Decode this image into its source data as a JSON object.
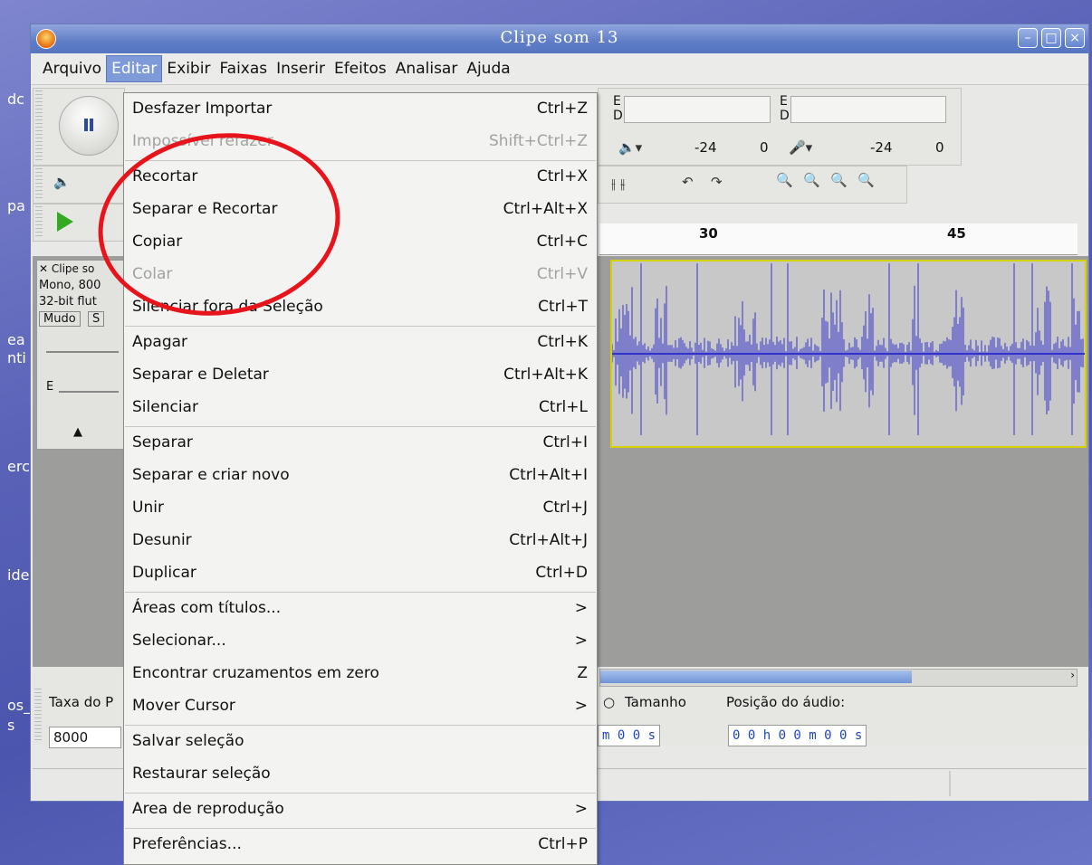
{
  "window": {
    "title": "Clipe som 13"
  },
  "menubar": [
    {
      "label": "Arquivo",
      "active": false
    },
    {
      "label": "Editar",
      "active": true
    },
    {
      "label": "Exibir",
      "active": false
    },
    {
      "label": "Faixas",
      "active": false
    },
    {
      "label": "Inserir",
      "active": false
    },
    {
      "label": "Efeitos",
      "active": false
    },
    {
      "label": "Analisar",
      "active": false
    },
    {
      "label": "Ajuda",
      "active": false
    }
  ],
  "meters": {
    "e": "E",
    "d": "D",
    "db1": "-24",
    "db1b": "0",
    "db2": "-24",
    "db2b": "0"
  },
  "ruler": {
    "t30": "30",
    "t45": "45"
  },
  "track": {
    "name": "Clipe so",
    "info1": "Mono, 800",
    "info2": "32-bit flut",
    "mute": "Mudo",
    "solo": "S",
    "gain_label": "E"
  },
  "selection_bar": {
    "rate_label": "Taxa do P",
    "rate_value": "8000",
    "length_label": "Tamanho",
    "position_label": "Posição do áudio:",
    "time1": "m 0 0 s",
    "time2": "0 0 h 0 0 m 0 0 s"
  },
  "edit_menu": {
    "items": [
      {
        "label": "Desfazer Importar",
        "accel": "Ctrl+Z",
        "disabled": false,
        "sep_after": false
      },
      {
        "label": "Impossível refazer",
        "accel": "Shift+Ctrl+Z",
        "disabled": true,
        "sep_after": true
      },
      {
        "label": "Recortar",
        "accel": "Ctrl+X",
        "disabled": false,
        "sep_after": false
      },
      {
        "label": "Separar e Recortar",
        "accel": "Ctrl+Alt+X",
        "disabled": false,
        "sep_after": false
      },
      {
        "label": "Copiar",
        "accel": "Ctrl+C",
        "disabled": false,
        "sep_after": false
      },
      {
        "label": "Colar",
        "accel": "Ctrl+V",
        "disabled": true,
        "sep_after": false
      },
      {
        "label": "Silenciar fora da Seleção",
        "accel": "Ctrl+T",
        "disabled": false,
        "sep_after": true
      },
      {
        "label": "Apagar",
        "accel": "Ctrl+K",
        "disabled": false,
        "sep_after": false
      },
      {
        "label": "Separar e Deletar",
        "accel": "Ctrl+Alt+K",
        "disabled": false,
        "sep_after": false
      },
      {
        "label": "Silenciar",
        "accel": "Ctrl+L",
        "disabled": false,
        "sep_after": true
      },
      {
        "label": "Separar",
        "accel": "Ctrl+I",
        "disabled": false,
        "sep_after": false
      },
      {
        "label": "Separar e criar novo",
        "accel": "Ctrl+Alt+I",
        "disabled": false,
        "sep_after": false
      },
      {
        "label": "Unir",
        "accel": "Ctrl+J",
        "disabled": false,
        "sep_after": false
      },
      {
        "label": "Desunir",
        "accel": "Ctrl+Alt+J",
        "disabled": false,
        "sep_after": false
      },
      {
        "label": "Duplicar",
        "accel": "Ctrl+D",
        "disabled": false,
        "sep_after": true
      },
      {
        "label": "Áreas com títulos...",
        "accel": ">",
        "disabled": false,
        "sep_after": false
      },
      {
        "label": "Selecionar...",
        "accel": ">",
        "disabled": false,
        "sep_after": false
      },
      {
        "label": "Encontrar cruzamentos em zero",
        "accel": "Z",
        "disabled": false,
        "sep_after": false
      },
      {
        "label": "Mover Cursor",
        "accel": ">",
        "disabled": false,
        "sep_after": true
      },
      {
        "label": "Salvar seleção",
        "accel": "",
        "disabled": false,
        "sep_after": false
      },
      {
        "label": "Restaurar seleção",
        "accel": "",
        "disabled": false,
        "sep_after": true
      },
      {
        "label": "Area de reprodução",
        "accel": ">",
        "disabled": false,
        "sep_after": true
      },
      {
        "label": "Preferências...",
        "accel": "Ctrl+P",
        "disabled": false,
        "sep_after": false
      }
    ]
  },
  "desktop_fragments": [
    "dc",
    "pa",
    "ea",
    "nti",
    "erc",
    "ide",
    "os_",
    "s"
  ],
  "colors": {
    "highlight": "#7e9ad8",
    "waveform": "#3333cc",
    "annotation": "#e8141c"
  }
}
